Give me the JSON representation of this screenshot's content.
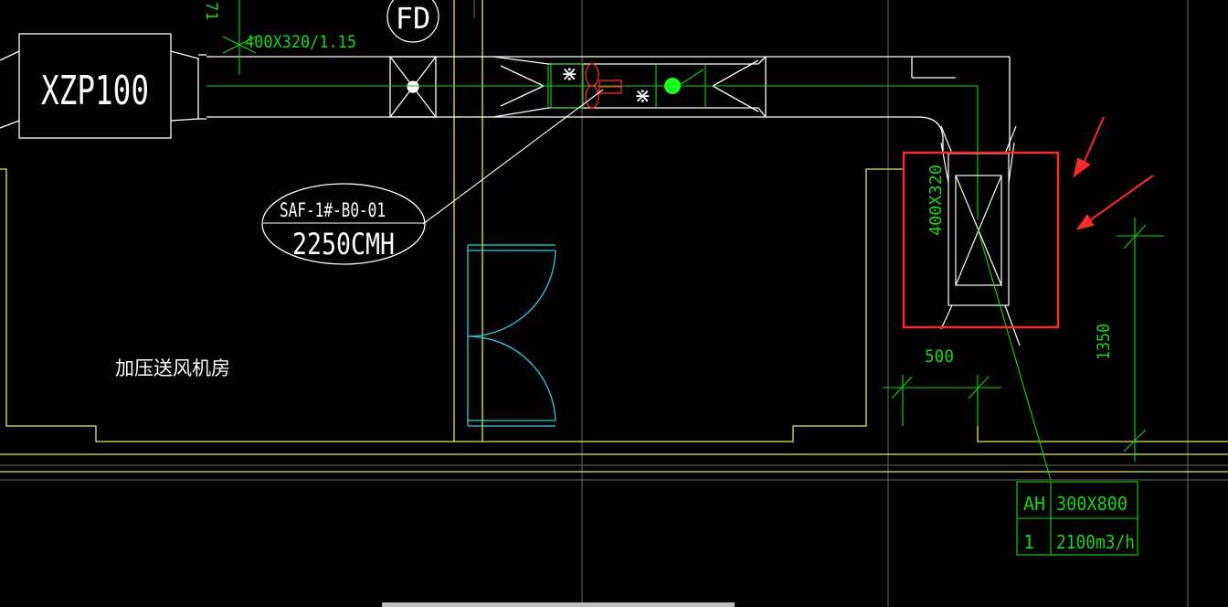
{
  "labels": {
    "unit_name": "XZP100",
    "duct_size_top": "400X320/1.15",
    "top_cut_number": "71",
    "damper_tag": "FD",
    "fan_tag": "SAF-1#-B0-01",
    "fan_flow": "2250CMH",
    "room_name": "加压送风机房",
    "duct_size_vertical": "400X320",
    "dim_width": "500",
    "dim_height": "1350"
  },
  "legend_table": {
    "header_code": "AH",
    "header_size": "300X800",
    "row_qty": "1",
    "row_flow": "2100m3/h"
  },
  "colors": {
    "background": "#000000",
    "duct_lines": "#ffffff",
    "dimension_lines": "#19d419",
    "wall_lines": "#e8e86a",
    "door_lines": "#2ad4e0",
    "highlight_box": "#ff2a2a",
    "arrows": "#ff2a2a",
    "fan_marker": "#1aff1a"
  }
}
